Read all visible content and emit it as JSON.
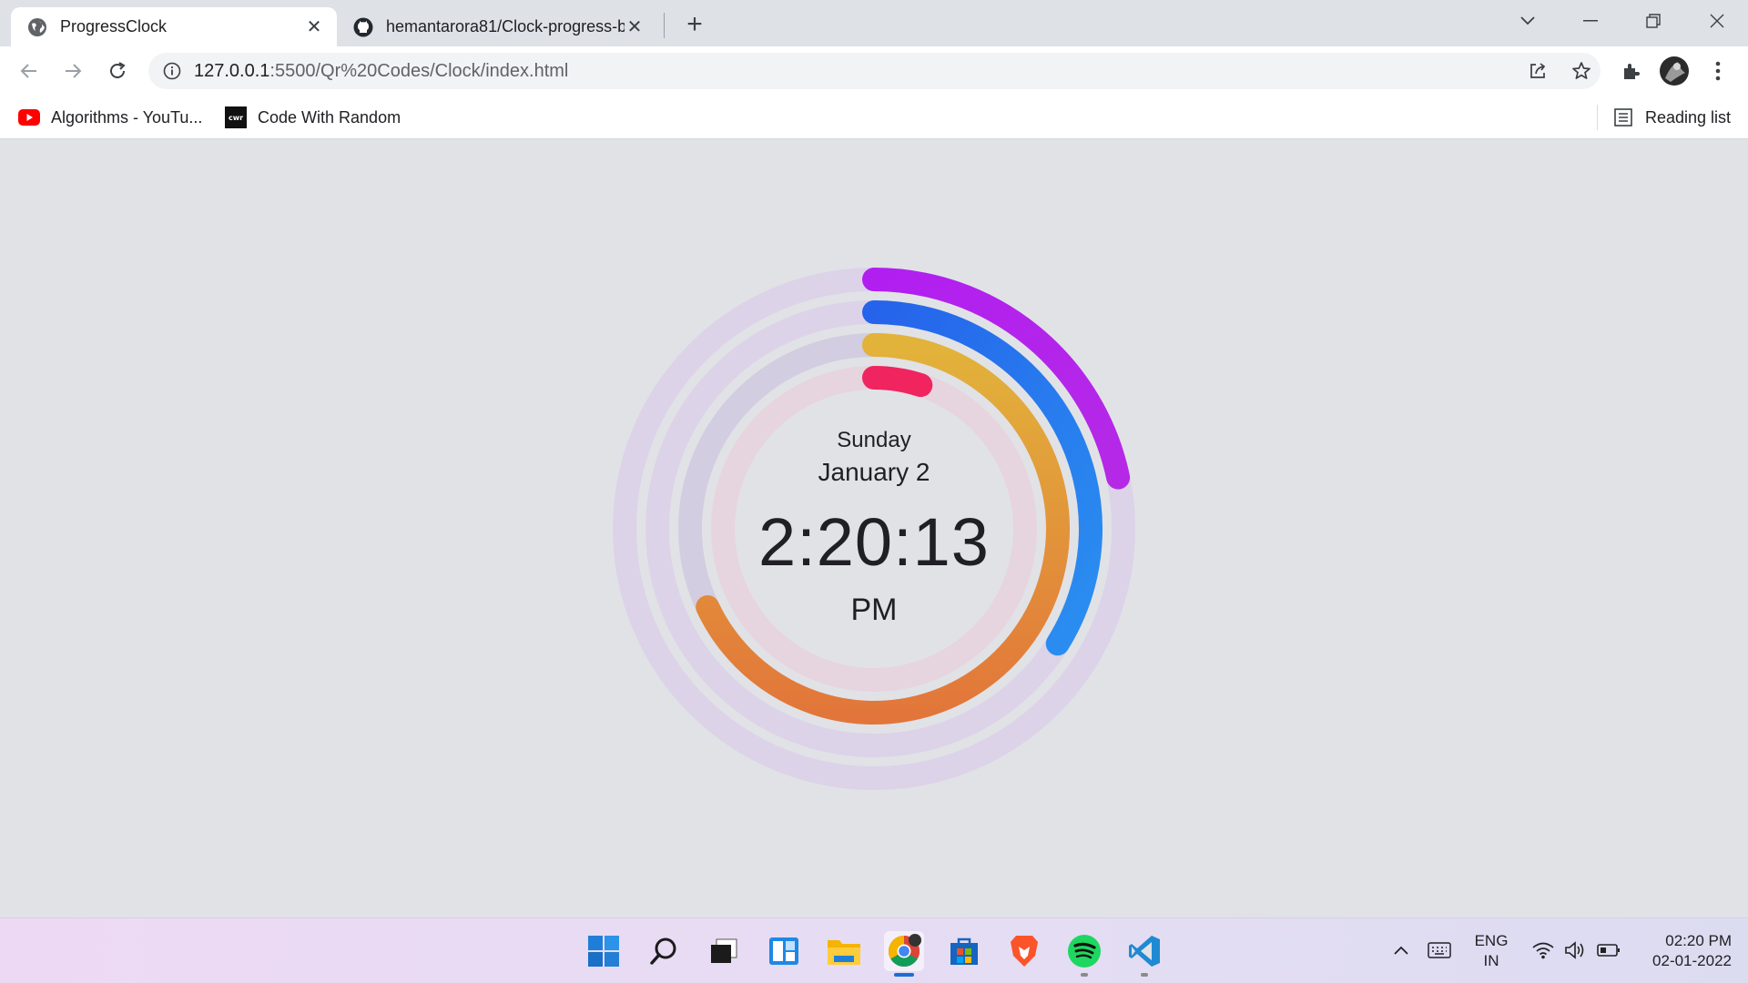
{
  "browser": {
    "tabs": [
      {
        "title": "ProgressClock",
        "active": true
      },
      {
        "title": "hemantarora81/Clock-progress-b",
        "active": false
      }
    ],
    "url_host": "127.0.0.1",
    "url_path": ":5500/Qr%20Codes/Clock/index.html",
    "bookmarks": [
      {
        "label": "Algorithms - YouTu...",
        "icon": "youtube-icon"
      },
      {
        "label": "Code With Random",
        "icon": "cwr-icon"
      }
    ],
    "reading_list": "Reading list"
  },
  "clock": {
    "day": "Sunday",
    "date": "January 2",
    "time": "2:20:13",
    "ampm": "PM",
    "rings": [
      {
        "name": "seconds",
        "fraction": 0.217,
        "color_start": "#b11ff0",
        "color_end": "#b529e6",
        "track": "#dcd3e8"
      },
      {
        "name": "minutes",
        "fraction": 0.339,
        "color_start": "#2563eb",
        "color_end": "#2a8ff0",
        "track": "#dcd3e8"
      },
      {
        "name": "hours",
        "fraction": 0.68,
        "color_start": "#e2b33a",
        "color_end": "#e2763a",
        "track": "#d2cde0"
      },
      {
        "name": "day",
        "fraction": 0.05,
        "color_start": "#f0245e",
        "color_end": "#f0245e",
        "track": "#e6d4df"
      }
    ]
  },
  "taskbar": {
    "apps": [
      "windows-start-icon",
      "search-icon",
      "task-view-icon",
      "widgets-icon",
      "file-explorer-icon",
      "chrome-icon",
      "store-icon",
      "brave-icon",
      "spotify-icon",
      "vscode-icon"
    ],
    "lang_top": "ENG",
    "lang_bottom": "IN",
    "time": "02:20 PM",
    "date": "02-01-2022"
  }
}
